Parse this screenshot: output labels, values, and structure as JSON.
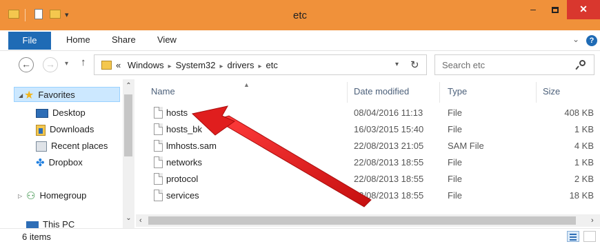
{
  "window": {
    "title": "etc",
    "min": "–",
    "close": "✕"
  },
  "ribbon": {
    "tabs": [
      "File",
      "Home",
      "Share",
      "View"
    ],
    "help": "?",
    "chevron": "⌄"
  },
  "address": {
    "prefix": "«",
    "crumbs": [
      "Windows",
      "System32",
      "drivers",
      "etc"
    ],
    "separator": "▸",
    "search_placeholder": "Search etc"
  },
  "nav": {
    "favorites": "Favorites",
    "items": [
      "Desktop",
      "Downloads",
      "Recent places",
      "Dropbox"
    ],
    "homegroup": "Homegroup",
    "this_pc": "This PC"
  },
  "columns": {
    "name": "Name",
    "date": "Date modified",
    "type": "Type",
    "size": "Size"
  },
  "files": [
    {
      "name": "hosts",
      "date": "08/04/2016 11:13",
      "type": "File",
      "size": "408 KB"
    },
    {
      "name": "hosts_bk",
      "date": "16/03/2015 15:40",
      "type": "File",
      "size": "1 KB"
    },
    {
      "name": "lmhosts.sam",
      "date": "22/08/2013 21:05",
      "type": "SAM File",
      "size": "4 KB"
    },
    {
      "name": "networks",
      "date": "22/08/2013 18:55",
      "type": "File",
      "size": "1 KB"
    },
    {
      "name": "protocol",
      "date": "22/08/2013 18:55",
      "type": "File",
      "size": "2 KB"
    },
    {
      "name": "services",
      "date": "22/08/2013 18:55",
      "type": "File",
      "size": "18 KB"
    }
  ],
  "status": {
    "items": "6 items"
  },
  "colors": {
    "titlebar": "#f0913a",
    "file_tab": "#1f6bb5",
    "close": "#d9372e",
    "arrow": "#e01e1e"
  },
  "icons": [
    "folder-icon",
    "star-icon",
    "desktop-icon",
    "downloads-icon",
    "recent-places-icon",
    "dropbox-icon",
    "homegroup-icon",
    "file-icon",
    "search-icon",
    "refresh-icon"
  ]
}
